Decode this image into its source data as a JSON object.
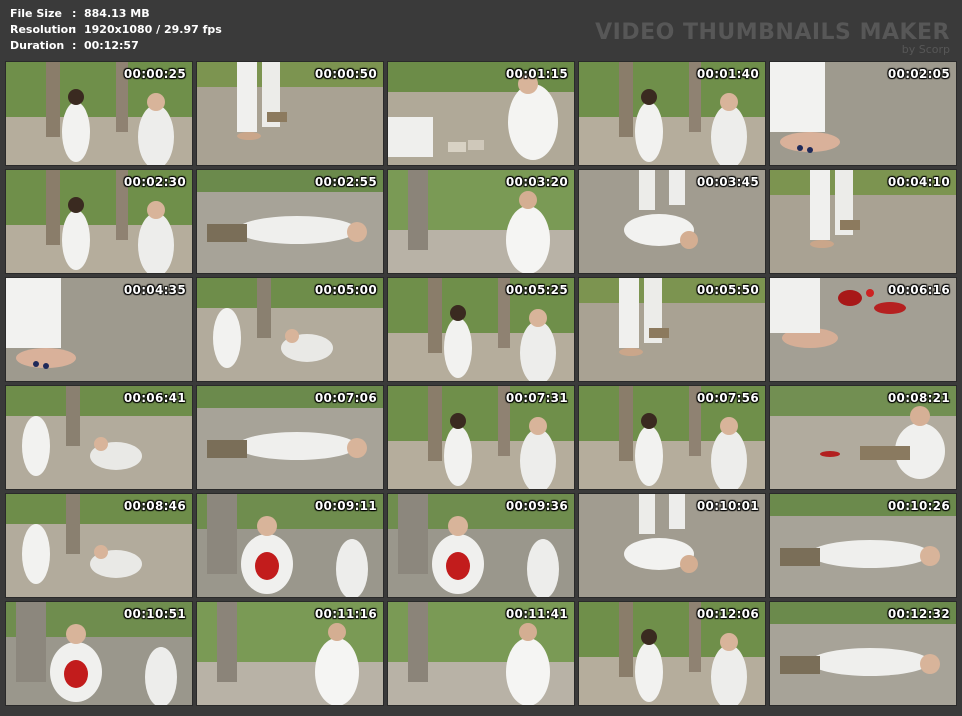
{
  "info": {
    "file_size_label": "File Size",
    "file_size_value": "884.13 MB",
    "resolution_label": "Resolution",
    "resolution_value": "1920x1080 / 29.97 fps",
    "duration_label": "Duration",
    "duration_value": "00:12:57",
    "separator": ":"
  },
  "watermark": {
    "title": "VIDEO THUMBNAILS MAKER",
    "by": "by Scorp"
  },
  "thumbnails": [
    {
      "ts": "00:00:25",
      "scene": "pillars-two"
    },
    {
      "ts": "00:00:50",
      "scene": "legs-floor"
    },
    {
      "ts": "00:01:15",
      "scene": "bricks"
    },
    {
      "ts": "00:01:40",
      "scene": "pillars-two"
    },
    {
      "ts": "00:02:05",
      "scene": "feet"
    },
    {
      "ts": "00:02:30",
      "scene": "pillars-two"
    },
    {
      "ts": "00:02:55",
      "scene": "lying"
    },
    {
      "ts": "00:03:20",
      "scene": "pillars-one"
    },
    {
      "ts": "00:03:45",
      "scene": "lying-top"
    },
    {
      "ts": "00:04:10",
      "scene": "legs-floor"
    },
    {
      "ts": "00:04:35",
      "scene": "feet"
    },
    {
      "ts": "00:05:00",
      "scene": "kneel"
    },
    {
      "ts": "00:05:25",
      "scene": "pillars-two"
    },
    {
      "ts": "00:05:50",
      "scene": "legs-floor"
    },
    {
      "ts": "00:06:16",
      "scene": "feet-red"
    },
    {
      "ts": "00:06:41",
      "scene": "kneel"
    },
    {
      "ts": "00:07:06",
      "scene": "lying"
    },
    {
      "ts": "00:07:31",
      "scene": "pillars-two"
    },
    {
      "ts": "00:07:56",
      "scene": "pillars-two"
    },
    {
      "ts": "00:08:21",
      "scene": "sitting"
    },
    {
      "ts": "00:08:46",
      "scene": "kneel"
    },
    {
      "ts": "00:09:11",
      "scene": "red-shirt"
    },
    {
      "ts": "00:09:36",
      "scene": "red-shirt"
    },
    {
      "ts": "00:10:01",
      "scene": "lying-top"
    },
    {
      "ts": "00:10:26",
      "scene": "lying"
    },
    {
      "ts": "00:10:51",
      "scene": "red-shirt"
    },
    {
      "ts": "00:11:16",
      "scene": "pillars-one"
    },
    {
      "ts": "00:11:41",
      "scene": "pillars-one"
    },
    {
      "ts": "00:12:06",
      "scene": "pillars-two"
    },
    {
      "ts": "00:12:32",
      "scene": "lying"
    }
  ]
}
